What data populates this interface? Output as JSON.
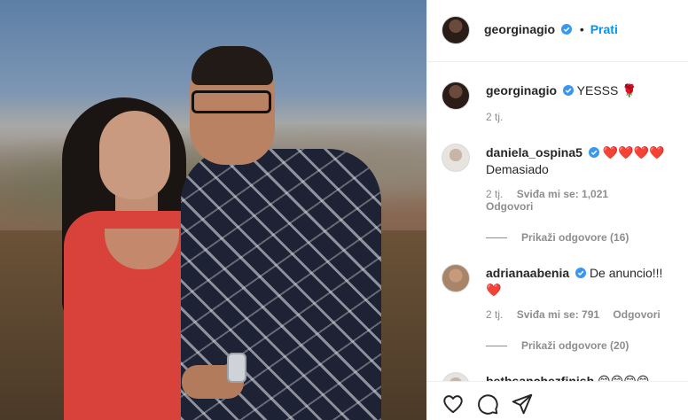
{
  "post": {
    "author": "georginagio",
    "follow_label": "Prati",
    "dot": "•"
  },
  "caption": {
    "username": "georginagio",
    "text": "YESSS 🌹",
    "time": "2 tj."
  },
  "comments": [
    {
      "username": "daniela_ospina5",
      "text_inline": "❤️❤️❤️❤️",
      "text_line2": "Demasiado",
      "time": "2 tj.",
      "likes": "Sviđa mi se: 1,021",
      "reply_label": "Odgovori",
      "view_replies": "Prikaži odgovore (16)"
    },
    {
      "username": "adrianaabenia",
      "text_inline": "De anuncio!!!",
      "text_line2": "❤️",
      "time": "2 tj.",
      "likes": "Sviđa mi se: 791",
      "reply_label": "Odgovori",
      "view_replies": "Prikaži odgovore (20)"
    }
  ],
  "partial_comment": {
    "username": "bethsanchezfinish",
    "text": "😊😊😊😊"
  },
  "icons": {
    "like": "heart-icon",
    "comment": "comment-icon",
    "share": "share-icon",
    "verified": "verified-badge-icon"
  },
  "colors": {
    "accent": "#0095f6",
    "verified": "#3897f0",
    "heart": "#e0245e",
    "muted": "#8e8e8e"
  }
}
